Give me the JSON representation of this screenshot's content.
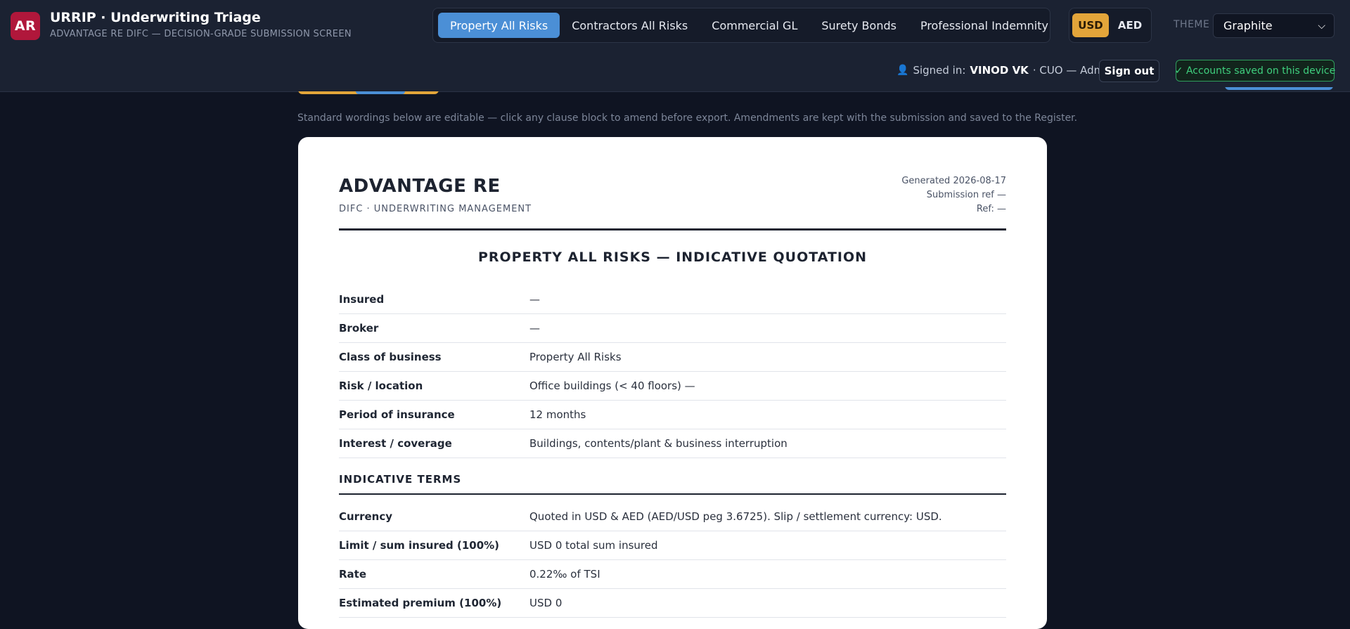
{
  "app": {
    "logo": "AR",
    "title": "URRIP · Underwriting Triage",
    "subtitle": "ADVANTAGE RE DIFC — DECISION-GRADE SUBMISSION SCREEN"
  },
  "tabs": [
    {
      "label": "Property All Risks",
      "active": true
    },
    {
      "label": "Contractors All Risks",
      "active": false
    },
    {
      "label": "Commercial GL",
      "active": false
    },
    {
      "label": "Surety Bonds",
      "active": false
    },
    {
      "label": "Professional Indemnity",
      "active": false
    }
  ],
  "currency": {
    "options": [
      "USD",
      "AED"
    ],
    "selected": "USD"
  },
  "theme": {
    "label": "THEME",
    "value": "Graphite"
  },
  "session": {
    "prefix": "Signed in:",
    "user": "VINOD VK",
    "role": "· CUO — Admin",
    "sign_out": "Sign out",
    "saved": "✓ Accounts saved on this device"
  },
  "note": "Standard wordings below are editable — click any clause block to amend before export. Amendments are kept with the submission and saved to the Register.",
  "document": {
    "firm": "ADVANTAGE RE",
    "firm_sub": "DIFC · UNDERWRITING MANAGEMENT",
    "generated": "Generated 2026-08-17",
    "submission_ref": "Submission ref —",
    "ref": "Ref: —",
    "title": "PROPERTY ALL RISKS — INDICATIVE QUOTATION",
    "details": [
      {
        "k": "Insured",
        "v": "—"
      },
      {
        "k": "Broker",
        "v": "—"
      },
      {
        "k": "Class of business",
        "v": "Property All Risks"
      },
      {
        "k": "Risk / location",
        "v": "Office buildings (< 40 floors) —"
      },
      {
        "k": "Period of insurance",
        "v": "12 months"
      },
      {
        "k": "Interest / coverage",
        "v": "Buildings, contents/plant & business interruption"
      }
    ],
    "section_terms": "INDICATIVE TERMS",
    "terms": [
      {
        "k": "Currency",
        "v": "Quoted in USD & AED (AED/USD peg 3.6725). Slip / settlement currency: USD."
      },
      {
        "k": "Limit / sum insured (100%)",
        "v": "USD 0 total sum insured"
      },
      {
        "k": "Rate",
        "v": "0.22‰ of TSI"
      },
      {
        "k": "Estimated premium (100%)",
        "v": "USD 0"
      }
    ]
  },
  "colors": {
    "background": "#0f1422",
    "header": "#1b2232",
    "tab_active": "#4b8fd6",
    "currency_active": "#e3a53a",
    "logo": "#b0173b",
    "saved_green": "#3fcf7e"
  }
}
